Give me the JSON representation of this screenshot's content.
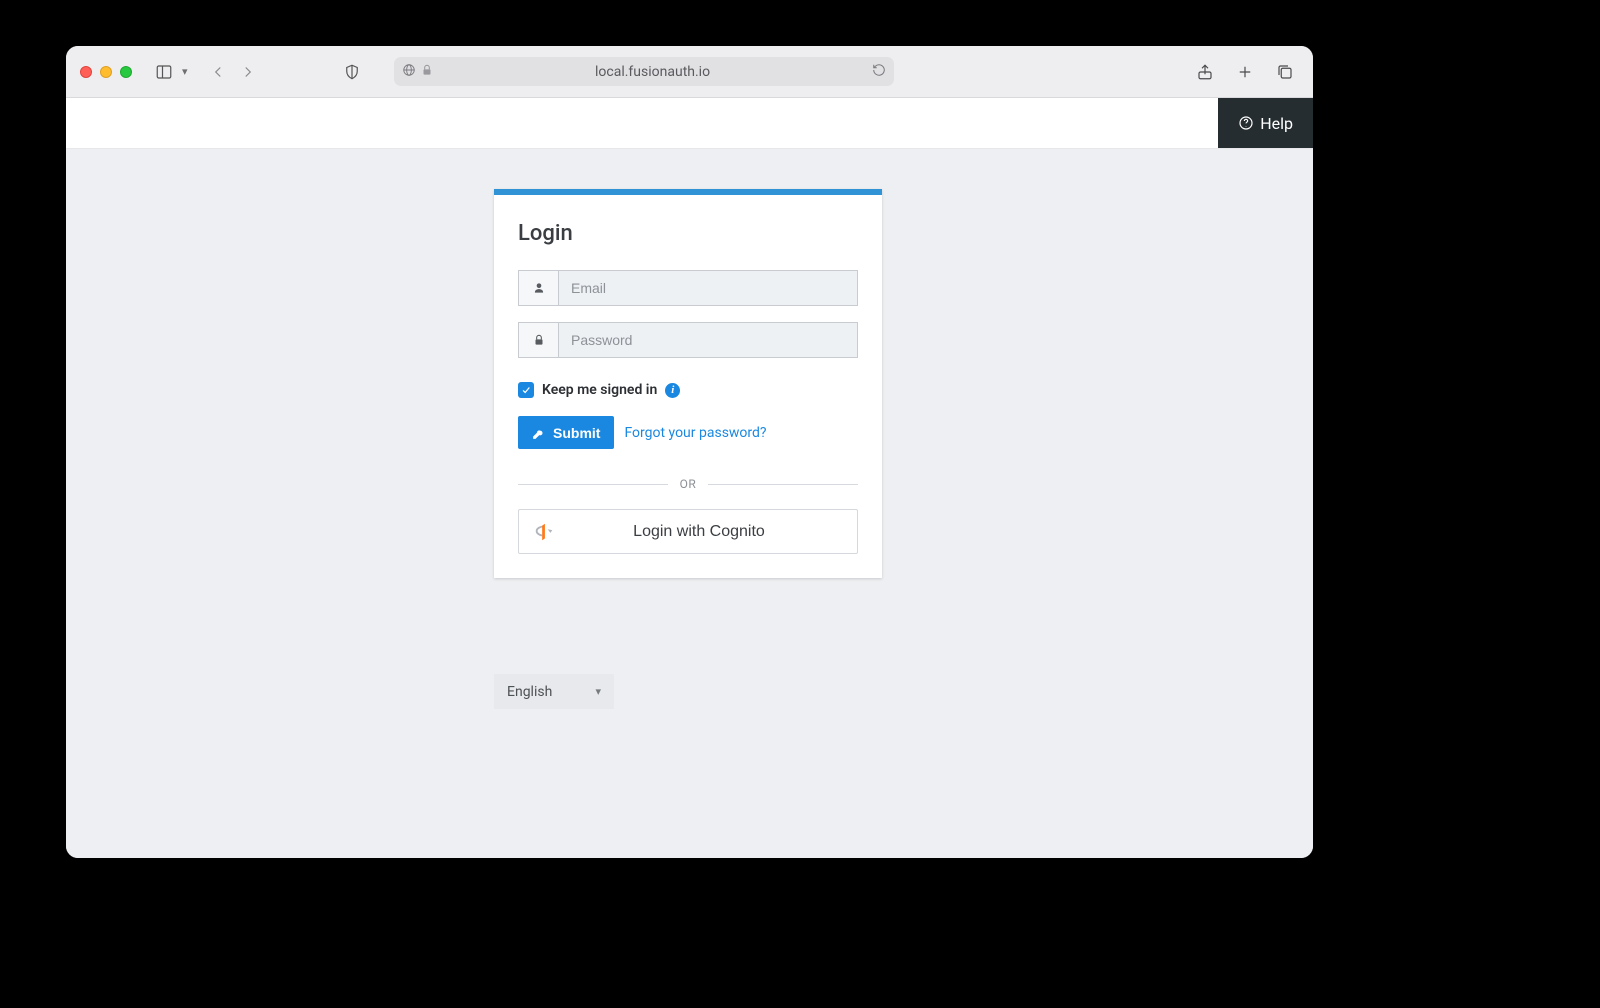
{
  "browser": {
    "url": "local.fusionauth.io"
  },
  "header": {
    "help_label": "Help"
  },
  "login": {
    "title": "Login",
    "email_placeholder": "Email",
    "password_placeholder": "Password",
    "keep_signed_label": "Keep me signed in",
    "keep_signed_checked": true,
    "submit_label": "Submit",
    "forgot_label": "Forgot your password?",
    "or_label": "OR",
    "idp_label": "Login with Cognito"
  },
  "language": {
    "selected": "English"
  }
}
